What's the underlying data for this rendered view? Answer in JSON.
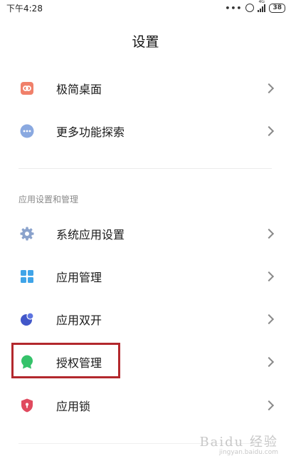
{
  "status_bar": {
    "time": "下午4:28",
    "dots": "•••",
    "network_label": "4G",
    "battery": "38"
  },
  "page": {
    "title": "设置"
  },
  "top_items": [
    {
      "label": "极简桌面",
      "icon": "minimal-desktop-icon",
      "color": "#f0806a"
    },
    {
      "label": "更多功能探索",
      "icon": "more-features-icon",
      "color": "#8aa9e0"
    }
  ],
  "section": {
    "header": "应用设置和管理",
    "items": [
      {
        "label": "系统应用设置",
        "icon": "system-app-settings-icon",
        "color": "#8aa2cc"
      },
      {
        "label": "应用管理",
        "icon": "app-management-icon",
        "color": "#3fa4e8"
      },
      {
        "label": "应用双开",
        "icon": "dual-apps-icon",
        "color": "#4257c9"
      },
      {
        "label": "授权管理",
        "icon": "permission-management-icon",
        "color": "#35c26a"
      },
      {
        "label": "应用锁",
        "icon": "app-lock-icon",
        "color": "#e04a5e"
      }
    ]
  },
  "annotation": {
    "highlight_color": "#b3282d"
  },
  "watermark": {
    "main": "Baidu 经验",
    "sub": "jingyan.baidu.com"
  }
}
